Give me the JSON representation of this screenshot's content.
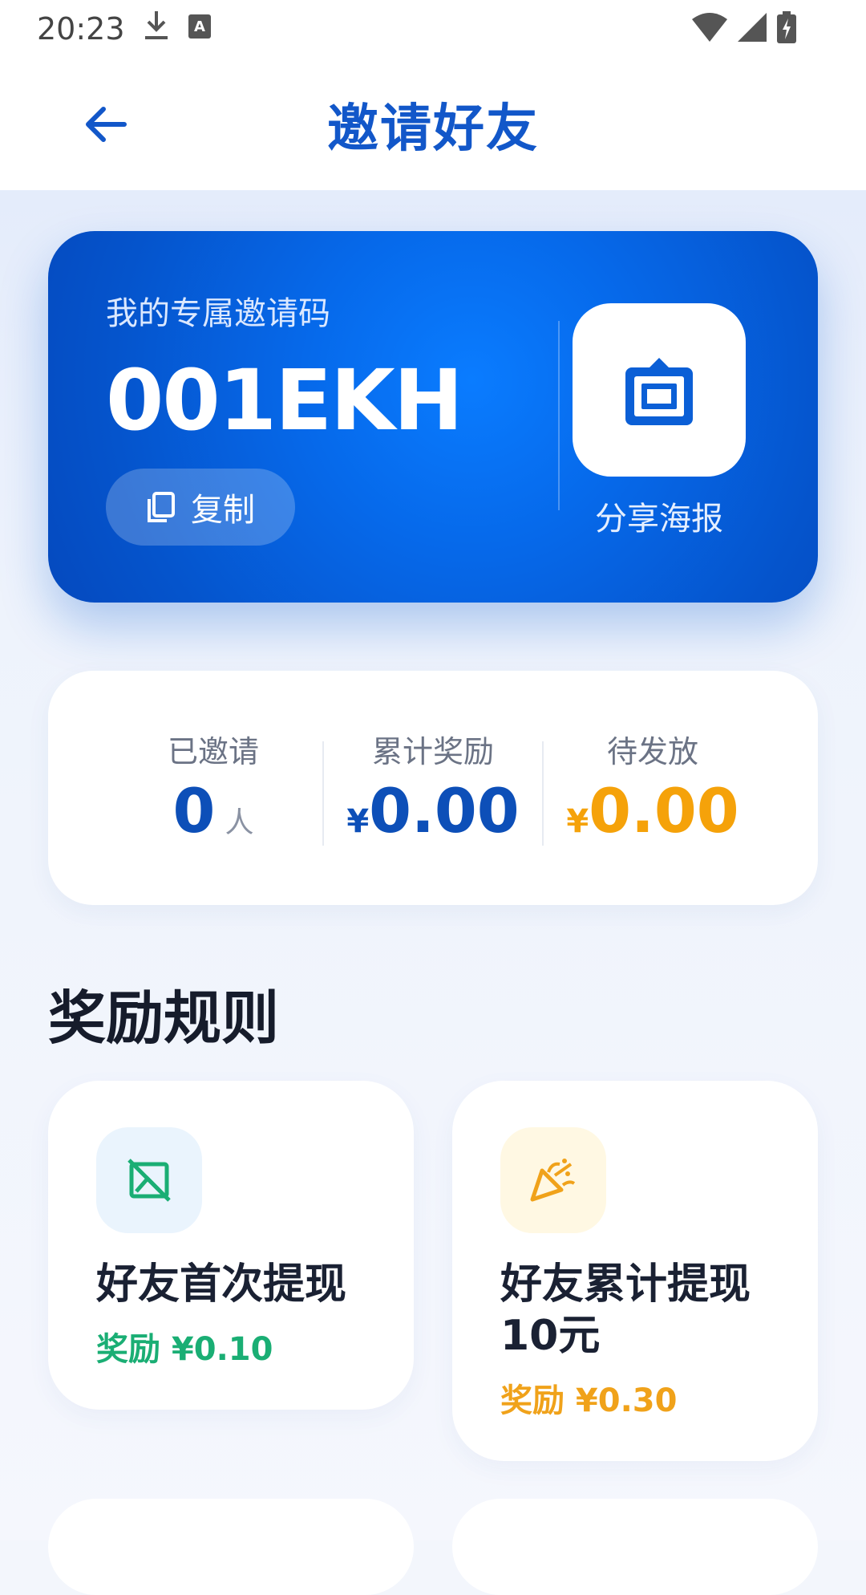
{
  "status_bar": {
    "time": "20:23"
  },
  "header": {
    "title": "邀请好友"
  },
  "invite_card": {
    "code_label": "我的专属邀请码",
    "code": "001EKH",
    "copy_label": "复制",
    "share_label": "分享海报"
  },
  "stats": [
    {
      "label": "已邀请",
      "value": "0",
      "unit": "人",
      "color": "#0d4fb8"
    },
    {
      "label": "累计奖励",
      "currency": "¥",
      "value": "0.00",
      "color": "#0d4fb8"
    },
    {
      "label": "待发放",
      "currency": "¥",
      "value": "0.00",
      "color": "#f5a20a"
    }
  ],
  "rules": {
    "title": "奖励规则",
    "items": [
      {
        "title": "好友首次提现",
        "reward": "奖励 ¥0.10",
        "icon": "no-image-icon",
        "color": "#1aae74"
      },
      {
        "title": "好友累计提现10元",
        "reward": "奖励 ¥0.30",
        "icon": "party-popper-icon",
        "color": "#f0a21a"
      }
    ]
  },
  "colors": {
    "accent": "#1257c9",
    "card_blue": "#0669ea",
    "green": "#1aae74",
    "orange": "#f0a21a"
  }
}
